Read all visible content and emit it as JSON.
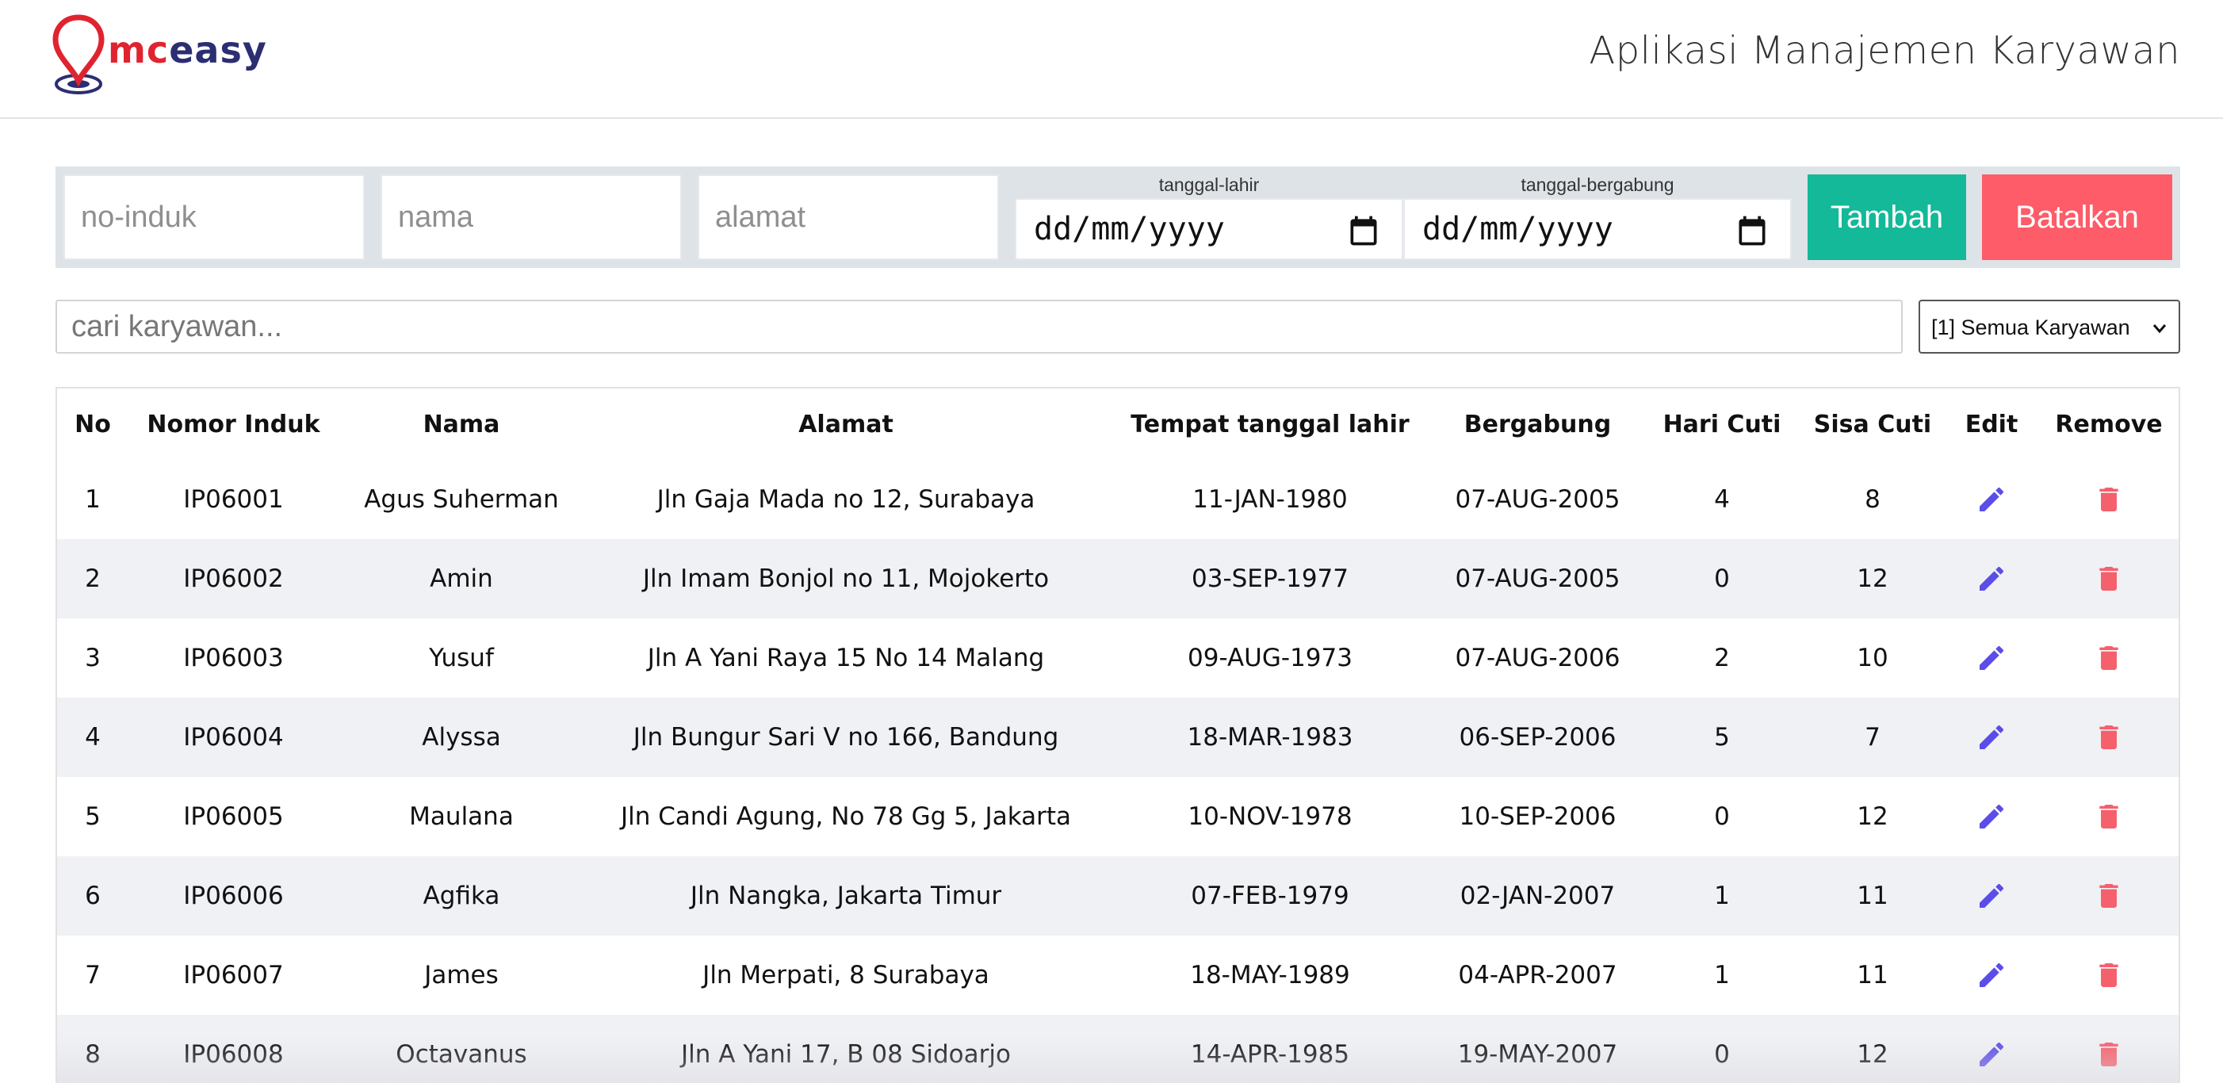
{
  "brand": {
    "logo_mc": "mc",
    "logo_easy": "easy",
    "logo_icon": "map-pin-icon",
    "colors": {
      "red": "#e0242f",
      "navy": "#2b2e72"
    }
  },
  "header": {
    "title": "Aplikasi Manajemen Karyawan"
  },
  "form": {
    "no_induk_placeholder": "no-induk",
    "nama_placeholder": "nama",
    "alamat_placeholder": "alamat",
    "tanggal_lahir_label": "tanggal-lahir",
    "tanggal_lahir_value": "dd/mm/yyyy",
    "tanggal_bergabung_label": "tanggal-bergabung",
    "tanggal_bergabung_value": "dd/mm/yyyy",
    "add_label": "Tambah",
    "cancel_label": "Batalkan",
    "colors": {
      "add": "#13b998",
      "cancel": "#fd5c68"
    }
  },
  "search": {
    "placeholder": "cari karyawan...",
    "filter_selected": "[1] Semua Karyawan"
  },
  "table": {
    "headers": [
      "No",
      "Nomor Induk",
      "Nama",
      "Alamat",
      "Tempat tanggal lahir",
      "Bergabung",
      "Hari Cuti",
      "Sisa Cuti",
      "Edit",
      "Remove"
    ],
    "rows": [
      [
        "1",
        "IP06001",
        "Agus Suherman",
        "Jln Gaja Mada no 12, Surabaya",
        "11-JAN-1980",
        "07-AUG-2005",
        "4",
        "8"
      ],
      [
        "2",
        "IP06002",
        "Amin",
        "Jln Imam Bonjol no 11, Mojokerto",
        "03-SEP-1977",
        "07-AUG-2005",
        "0",
        "12"
      ],
      [
        "3",
        "IP06003",
        "Yusuf",
        "Jln A Yani Raya 15 No 14 Malang",
        "09-AUG-1973",
        "07-AUG-2006",
        "2",
        "10"
      ],
      [
        "4",
        "IP06004",
        "Alyssa",
        "Jln Bungur Sari V no 166, Bandung",
        "18-MAR-1983",
        "06-SEP-2006",
        "5",
        "7"
      ],
      [
        "5",
        "IP06005",
        "Maulana",
        "Jln Candi Agung, No 78 Gg 5, Jakarta",
        "10-NOV-1978",
        "10-SEP-2006",
        "0",
        "12"
      ],
      [
        "6",
        "IP06006",
        "Agfika",
        "Jln Nangka, Jakarta Timur",
        "07-FEB-1979",
        "02-JAN-2007",
        "1",
        "11"
      ],
      [
        "7",
        "IP06007",
        "James",
        "Jln Merpati, 8 Surabaya",
        "18-MAY-1989",
        "04-APR-2007",
        "1",
        "11"
      ],
      [
        "8",
        "IP06008",
        "Octavanus",
        "Jln A Yani 17, B 08 Sidoarjo",
        "14-APR-1985",
        "19-MAY-2007",
        "0",
        "12"
      ]
    ],
    "edit_icon": "pencil-icon",
    "remove_icon": "trash-icon",
    "colors": {
      "edit": "#5b4de8",
      "remove": "#f5606d",
      "stripe": "#f0f1f5"
    }
  }
}
